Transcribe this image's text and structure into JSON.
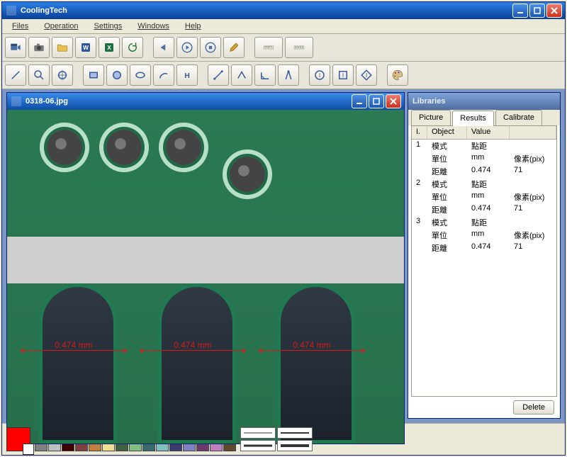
{
  "app": {
    "title": "CoolingTech"
  },
  "menus": {
    "files": "Files",
    "operation": "Operation",
    "settings": "Settings",
    "windows": "Windows",
    "help": "Help"
  },
  "toolbar1": {
    "video": "video-icon",
    "camera": "camera-icon",
    "folder": "folder-icon",
    "word": "word-icon",
    "excel": "excel-icon",
    "refresh": "refresh-icon",
    "prev": "prev-icon",
    "play": "play-icon",
    "stop": "stop-icon",
    "wrench": "settings-icon",
    "scale": "scale-icon",
    "ruler": "calibrate-icon"
  },
  "toolbar2": {
    "line": "line-tool-icon",
    "zoom": "zoom-tool-icon",
    "target": "target-tool-icon",
    "rect": "rectangle-tool-icon",
    "circle": "circle-tool-icon",
    "ellipse": "ellipse-tool-icon",
    "arc": "arc-tool-icon",
    "htext": "h-text-tool-icon",
    "measure1": "measure-tool-icon",
    "measure2": "measure2-tool-icon",
    "angle": "angle-tool-icon",
    "compass": "compass-tool-icon",
    "info1": "info-circle-icon",
    "info2": "info-square-icon",
    "info3": "info-diamond-icon",
    "palette": "color-palette-icon"
  },
  "image_window": {
    "title": "0318-06.jpg"
  },
  "measurements": {
    "m1": "0.474 mm",
    "m2": "0.474 mm",
    "m3": "0.474 mm"
  },
  "libraries": {
    "title": "Libraries",
    "tabs": {
      "picture": "Picture",
      "results": "Results",
      "calibrate": "Calibrate"
    },
    "active_tab": "results",
    "columns": {
      "index": "I.",
      "object": "Object",
      "value": "Value"
    },
    "rows": [
      {
        "idx": "1",
        "r1": {
          "o": "模式",
          "va": "點距",
          "vb": ""
        },
        "r2": {
          "o": "單位",
          "va": "mm",
          "vb": "像素(pix)"
        },
        "r3": {
          "o": "距離",
          "va": "0.474",
          "vb": "71"
        }
      },
      {
        "idx": "2",
        "r1": {
          "o": "模式",
          "va": "點距",
          "vb": ""
        },
        "r2": {
          "o": "單位",
          "va": "mm",
          "vb": "像素(pix)"
        },
        "r3": {
          "o": "距離",
          "va": "0.474",
          "vb": "71"
        }
      },
      {
        "idx": "3",
        "r1": {
          "o": "模式",
          "va": "點距",
          "vb": ""
        },
        "r2": {
          "o": "單位",
          "va": "mm",
          "vb": "像素(pix)"
        },
        "r3": {
          "o": "距離",
          "va": "0.474",
          "vb": "71"
        }
      }
    ],
    "delete_button": "Delete"
  },
  "palette": {
    "current": "#ff0000",
    "colors": [
      "#000000",
      "#ffffff",
      "#800000",
      "#ff0000",
      "#ff8000",
      "#ffff00",
      "#008000",
      "#00ff00",
      "#008080",
      "#00ffff",
      "#000080",
      "#0000ff",
      "#800080",
      "#ff00ff",
      "#804000",
      "#808080",
      "#c0c0c0",
      "#400000",
      "#804040",
      "#c08040",
      "#f0e090",
      "#406040",
      "#80c080",
      "#3a6a6a",
      "#80c0c0",
      "#3a3a70",
      "#8080c0",
      "#6a3a6a",
      "#c080c0",
      "#604830"
    ]
  }
}
